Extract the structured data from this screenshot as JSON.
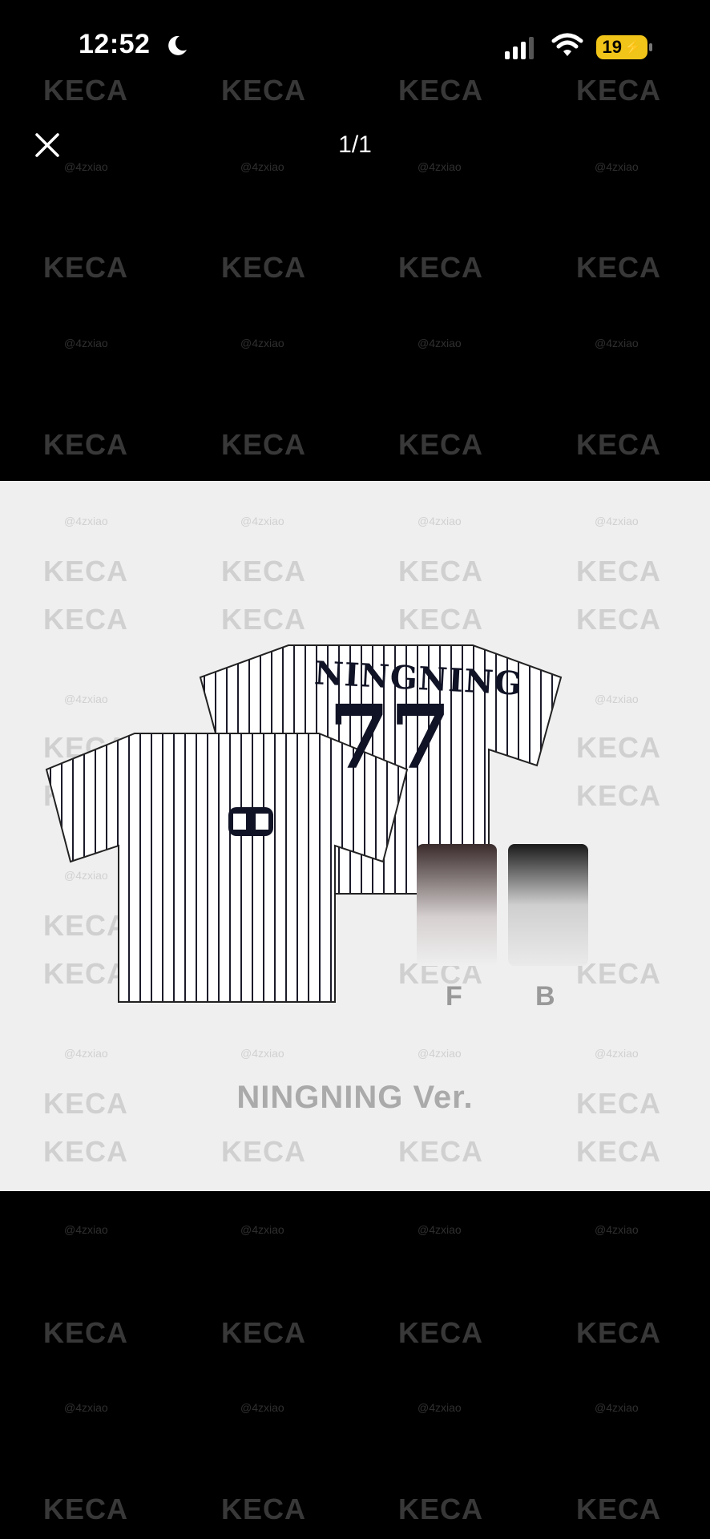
{
  "status": {
    "time": "12:52",
    "battery": "19",
    "icons": [
      "moon-icon",
      "signal-icon",
      "wifi-icon",
      "battery-icon"
    ]
  },
  "viewer": {
    "page_indicator": "1/1",
    "close_icon": "close-icon"
  },
  "image": {
    "back_name": "NINGNING",
    "back_number": "77",
    "front_card_label": "F",
    "back_card_label": "B",
    "caption": "NINGNING Ver."
  },
  "watermark": {
    "brand": "KECA",
    "handle": "@4zxiao"
  }
}
